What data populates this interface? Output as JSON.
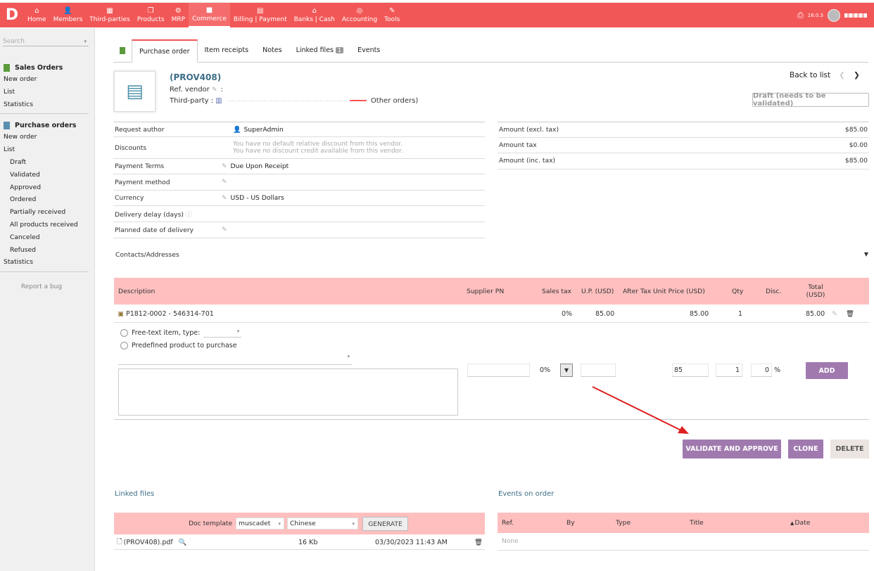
{
  "app": {
    "logo": "D",
    "version": "16.0.3"
  },
  "topnav": [
    {
      "label": "Home",
      "icon": "⌂"
    },
    {
      "label": "Members",
      "icon": "👤"
    },
    {
      "label": "Third-parties",
      "icon": "▦"
    },
    {
      "label": "Products",
      "icon": "❒"
    },
    {
      "label": "MRP",
      "icon": "⚙"
    },
    {
      "label": "Commerce",
      "icon": "■"
    },
    {
      "label": "Billing | Payment",
      "icon": "▤"
    },
    {
      "label": "Banks | Cash",
      "icon": "⌂"
    },
    {
      "label": "Accounting",
      "icon": "◎"
    },
    {
      "label": "Tools",
      "icon": "✎"
    }
  ],
  "sidebar": {
    "search_placeholder": "Search",
    "sales": {
      "title": "Sales Orders",
      "links": [
        "New order",
        "List",
        "Statistics"
      ]
    },
    "purchase": {
      "title": "Purchase orders",
      "links_top": [
        "New order",
        "List"
      ],
      "sub": [
        "Draft",
        "Validated",
        "Approved",
        "Ordered",
        "Partially received",
        "All products received",
        "Canceled",
        "Refused"
      ],
      "links_bottom": [
        "Statistics"
      ]
    },
    "report_bug": "Report a bug"
  },
  "tabs": [
    {
      "label": "Purchase order"
    },
    {
      "label": "Item receipts"
    },
    {
      "label": "Notes"
    },
    {
      "label": "Linked files",
      "badge": "1"
    },
    {
      "label": "Events"
    }
  ],
  "header": {
    "ref": "(PROV408)",
    "ref_vendor_label": "Ref. vendor",
    "third_party_label": "Third-party :",
    "other_orders": "Other orders)",
    "back_to_list": "Back to list",
    "status": "Draft (needs to be validated)"
  },
  "info": {
    "request_author": {
      "label": "Request author",
      "value": "SuperAdmin"
    },
    "discounts": {
      "label": "Discounts",
      "line1": "You have no default relative discount from this vendor.",
      "line2": "You have no discount credit available from this vendor."
    },
    "payment_terms": {
      "label": "Payment Terms",
      "value": "Due Upon Receipt"
    },
    "payment_method": {
      "label": "Payment method",
      "value": ""
    },
    "currency": {
      "label": "Currency",
      "value": "USD - US Dollars"
    },
    "delivery_delay": {
      "label": "Delivery delay (days)",
      "value": ""
    },
    "planned_date": {
      "label": "Planned date of delivery",
      "value": ""
    }
  },
  "amounts": [
    {
      "label": "Amount (excl. tax)",
      "value": "$85.00"
    },
    {
      "label": "Amount tax",
      "value": "$0.00"
    },
    {
      "label": "Amount (inc. tax)",
      "value": "$85.00"
    }
  ],
  "contacts_label": "Contacts/Addresses",
  "lines": {
    "columns": {
      "description": "Description",
      "supplier_pn": "Supplier PN",
      "sales_tax": "Sales tax",
      "up": "U.P. (USD)",
      "after_tax": "After Tax Unit Price (USD)",
      "qty": "Qty",
      "disc": "Disc.",
      "total1": "Total",
      "total2": "(USD)"
    },
    "rows": [
      {
        "description": "P1812-0002 - 546314-701",
        "sales_tax": "0%",
        "up": "85.00",
        "after_tax": "85.00",
        "qty": "1",
        "total": "85.00"
      }
    ]
  },
  "addform": {
    "free_text_label": "Free-text item, type:",
    "predefined_label": "Predefined product to purchase",
    "tax_value": "0%",
    "after_tax_value": "85",
    "qty_value": "1",
    "disc_value": "0",
    "disc_unit": "%",
    "add_button": "ADD"
  },
  "actions": {
    "validate": "VALIDATE AND APPROVE",
    "clone": "CLONE",
    "delete": "DELETE"
  },
  "linked_files": {
    "title": "Linked files",
    "doc_template_label": "Doc template",
    "template_value": "muscadet",
    "language_value": "Chinese",
    "generate": "GENERATE",
    "file": {
      "name": "(PROV408).pdf",
      "size": "16 Kb",
      "date": "03/30/2023 11:43 AM"
    }
  },
  "events": {
    "title": "Events on order",
    "columns": {
      "ref": "Ref.",
      "by": "By",
      "type": "Type",
      "title": "Title",
      "date": "Date"
    },
    "none": "None"
  }
}
